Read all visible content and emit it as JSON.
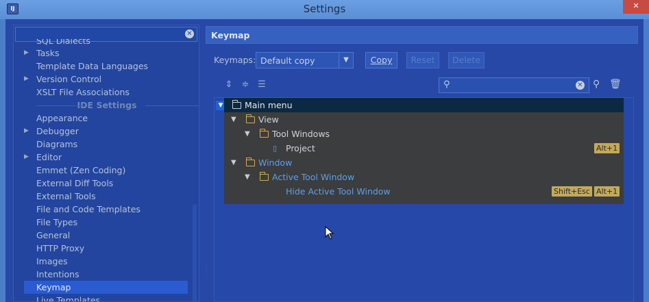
{
  "window": {
    "title": "Settings",
    "close_label": "✕",
    "app_icon_text": "IJ"
  },
  "sidebar": {
    "search_placeholder": "",
    "items": [
      {
        "label": "SQL Dialects",
        "arrow": ""
      },
      {
        "label": "Tasks",
        "arrow": "▶"
      },
      {
        "label": "Template Data Languages",
        "arrow": ""
      },
      {
        "label": "Version Control",
        "arrow": "▶"
      },
      {
        "label": "XSLT File Associations",
        "arrow": ""
      },
      {
        "label": "IDE Settings",
        "arrow": ""
      },
      {
        "label": "Appearance",
        "arrow": ""
      },
      {
        "label": "Debugger",
        "arrow": "▶"
      },
      {
        "label": "Diagrams",
        "arrow": ""
      },
      {
        "label": "Editor",
        "arrow": "▶"
      },
      {
        "label": "Emmet (Zen Coding)",
        "arrow": ""
      },
      {
        "label": "External Diff Tools",
        "arrow": ""
      },
      {
        "label": "External Tools",
        "arrow": ""
      },
      {
        "label": "File and Code Templates",
        "arrow": ""
      },
      {
        "label": "File Types",
        "arrow": ""
      },
      {
        "label": "General",
        "arrow": ""
      },
      {
        "label": "HTTP Proxy",
        "arrow": ""
      },
      {
        "label": "Images",
        "arrow": ""
      },
      {
        "label": "Intentions",
        "arrow": ""
      },
      {
        "label": "Keymap",
        "arrow": ""
      },
      {
        "label": "Live Templates",
        "arrow": ""
      }
    ]
  },
  "keymap": {
    "header": "Keymap",
    "keymaps_label": "Keymaps:",
    "selected_keymap": "Default copy",
    "copy_label": "Copy",
    "reset_label": "Reset",
    "delete_label": "Delete",
    "filter_value": "",
    "tree": [
      {
        "label": "Main menu",
        "shortcuts": []
      },
      {
        "label": "View",
        "shortcuts": []
      },
      {
        "label": "Tool Windows",
        "shortcuts": []
      },
      {
        "label": "Project",
        "shortcuts": [
          "Alt+1"
        ]
      },
      {
        "label": "Window",
        "shortcuts": []
      },
      {
        "label": "Active Tool Window",
        "shortcuts": []
      },
      {
        "label": "Hide Active Tool Window",
        "shortcuts": [
          "Shift+Esc",
          "Alt+1"
        ]
      }
    ]
  },
  "colors": {
    "window_bg": "#2748a6",
    "selection": "#2a5bd0",
    "tree_bg": "#3b3d3f",
    "folder": "#d8a95a",
    "shortcut_badge": "#c3a95a",
    "link_blue": "#5f9fe8"
  },
  "icons": {
    "expand_all": "expand-all-icon",
    "collapse_all": "collapse-all-icon",
    "edit_shortcut": "edit-shortcut-icon",
    "filter_search": "search-icon",
    "find_by_shortcut": "find-shortcut-icon",
    "clear_filter": "trash-icon"
  }
}
